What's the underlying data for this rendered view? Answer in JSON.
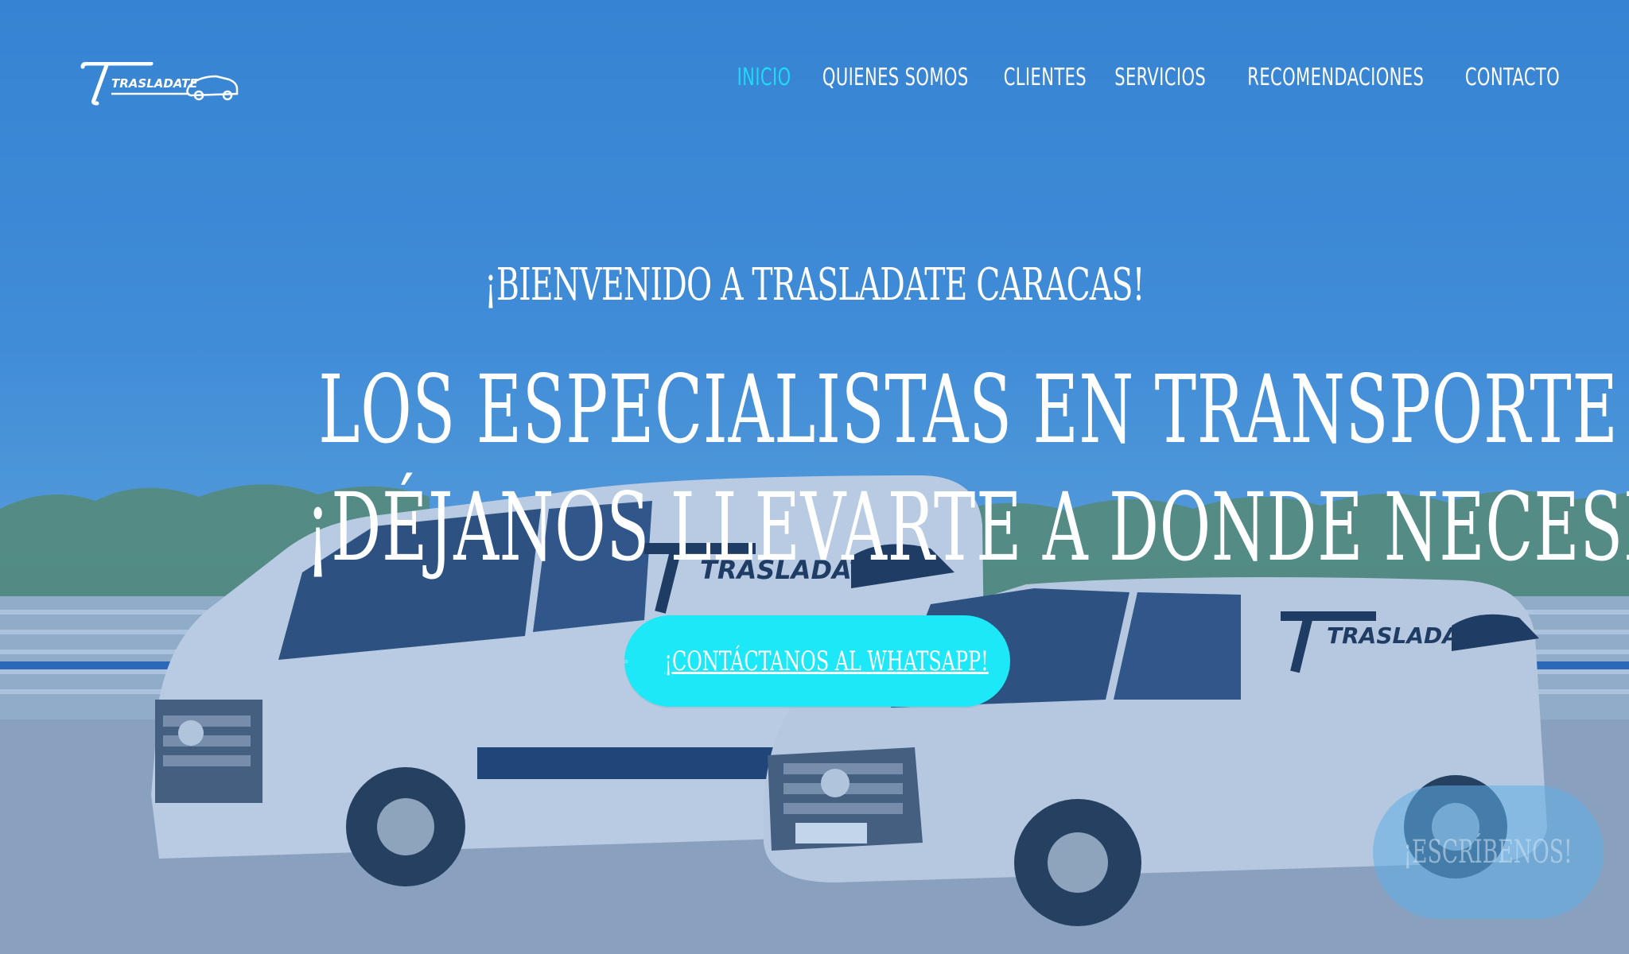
{
  "header": {
    "logo_text": "TRASLADATE",
    "nav": [
      {
        "label": "INICIO",
        "active": true
      },
      {
        "label": "QUIENES SOMOS",
        "active": false
      },
      {
        "label": "CLIENTES",
        "active": false
      },
      {
        "label": "SERVICIOS",
        "active": false
      },
      {
        "label": "RECOMENDACIONES",
        "active": false
      },
      {
        "label": "CONTACTO",
        "active": false
      }
    ]
  },
  "hero": {
    "welcome": "¡BIENVENIDO A TRASLADATE CARACAS!",
    "headline_line1": "LOS ESPECIALISTAS EN TRANSPORTE DE PERSONAL",
    "headline_line2": "¡DÉJANOS LLEVARTE A DONDE NECESITAS ESTAR!",
    "cta_label": "¡CONTÁCTANOS AL WHATSAPP!",
    "cta_icon": "whatsapp-icon",
    "van_logo_text": "TRASLADATE"
  },
  "floating_button": {
    "label": "¡ESCRÍBENOS!"
  },
  "colors": {
    "accent": "#1ce8f7",
    "active_nav": "#1fd9f5",
    "text": "#ffffff"
  }
}
